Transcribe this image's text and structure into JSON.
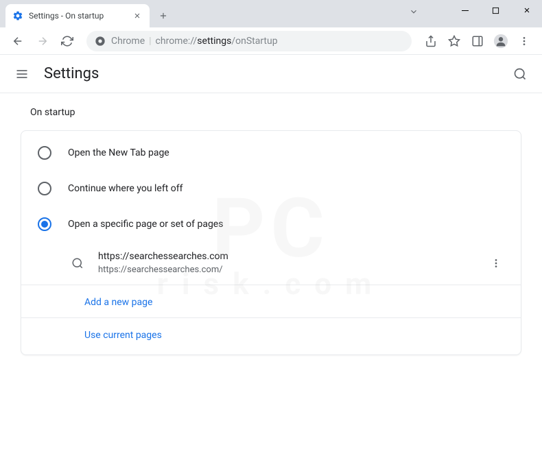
{
  "window": {
    "tab_title": "Settings - On startup"
  },
  "omnibox": {
    "scheme_label": "Chrome",
    "host": "chrome://",
    "path_bold": "settings",
    "path_rest": "/onStartup"
  },
  "settings": {
    "title": "Settings",
    "section_title": "On startup",
    "options": [
      {
        "label": "Open the New Tab page"
      },
      {
        "label": "Continue where you left off"
      },
      {
        "label": "Open a specific page or set of pages"
      }
    ],
    "page_entry": {
      "title": "https://searchessearches.com",
      "url": "https://searchessearches.com/"
    },
    "add_new_page": "Add a new page",
    "use_current_pages": "Use current pages"
  },
  "watermark": {
    "main": "PC",
    "sub": "risk.com"
  }
}
